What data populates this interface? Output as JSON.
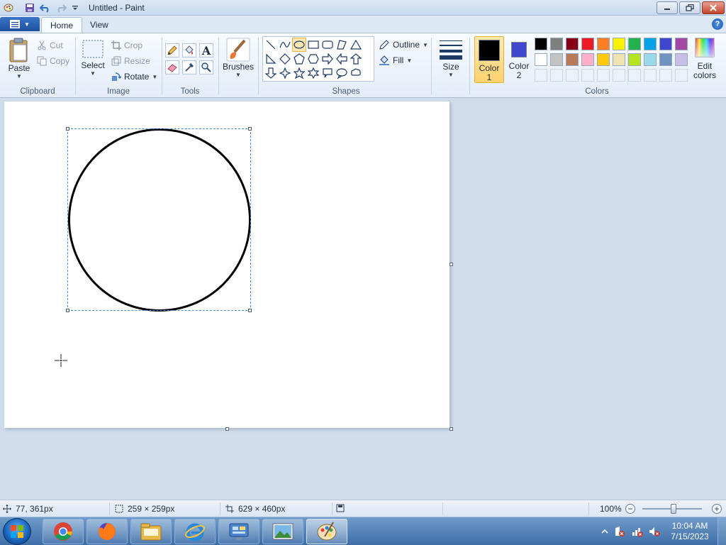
{
  "window": {
    "title": "Untitled - Paint",
    "quick_access": [
      "paint-app-icon",
      "save-icon",
      "undo-icon",
      "redo-icon",
      "customize-dropdown-icon"
    ],
    "controls": [
      "minimize-icon",
      "restore-icon",
      "close-icon"
    ]
  },
  "tabs": [
    {
      "label": "Home",
      "active": true
    },
    {
      "label": "View",
      "active": false
    }
  ],
  "ribbon": {
    "clipboard": {
      "group_label": "Clipboard",
      "paste": "Paste",
      "cut": "Cut",
      "copy": "Copy"
    },
    "image": {
      "group_label": "Image",
      "select": "Select",
      "crop": "Crop",
      "resize": "Resize",
      "rotate": "Rotate"
    },
    "tools": {
      "group_label": "Tools",
      "items": [
        "pencil-icon",
        "fill-bucket-icon",
        "text-icon",
        "eraser-icon",
        "color-picker-icon",
        "magnifier-icon"
      ]
    },
    "brushes": {
      "label": "Brushes"
    },
    "shapes": {
      "group_label": "Shapes",
      "outline": "Outline",
      "fill": "Fill",
      "items": [
        "line",
        "curve",
        "oval",
        "rectangle",
        "rounded-rectangle",
        "polygon",
        "triangle",
        "right-triangle",
        "diamond",
        "pentagon",
        "hexagon",
        "right-arrow",
        "left-arrow",
        "up-arrow",
        "down-arrow",
        "four-point-star",
        "five-point-star",
        "six-point-star",
        "rounded-callout",
        "oval-callout",
        "cloud-callout"
      ],
      "selected": "oval"
    },
    "size": {
      "label": "Size"
    },
    "colors": {
      "group_label": "Colors",
      "color1": {
        "label1": "Color",
        "label2": "1",
        "value": "#000000"
      },
      "color2": {
        "label1": "Color",
        "label2": "2",
        "value": "#3f48cc"
      },
      "edit": {
        "label1": "Edit",
        "label2": "colors"
      },
      "palette_row1": [
        "#000000",
        "#7f7f7f",
        "#880015",
        "#ed1c24",
        "#ff7f27",
        "#fff200",
        "#22b14c",
        "#00a2e8",
        "#3f48cc",
        "#a349a4"
      ],
      "palette_row2": [
        "#ffffff",
        "#c3c3c3",
        "#b97a57",
        "#ffaec9",
        "#ffc90e",
        "#efe4b0",
        "#b5e61d",
        "#99d9ea",
        "#7092be",
        "#c8bfe7"
      ]
    }
  },
  "status": {
    "cursor_pos": "77, 361px",
    "selection_size": "259 × 259px",
    "canvas_size": "629 × 460px",
    "zoom": "100%"
  },
  "taskbar": {
    "apps": [
      "chrome-icon",
      "firefox-icon",
      "file-explorer-icon",
      "internet-explorer-icon",
      "control-panel-icon",
      "photo-viewer-icon",
      "paint-icon"
    ],
    "time": "10:04 AM",
    "date": "7/15/2023"
  }
}
